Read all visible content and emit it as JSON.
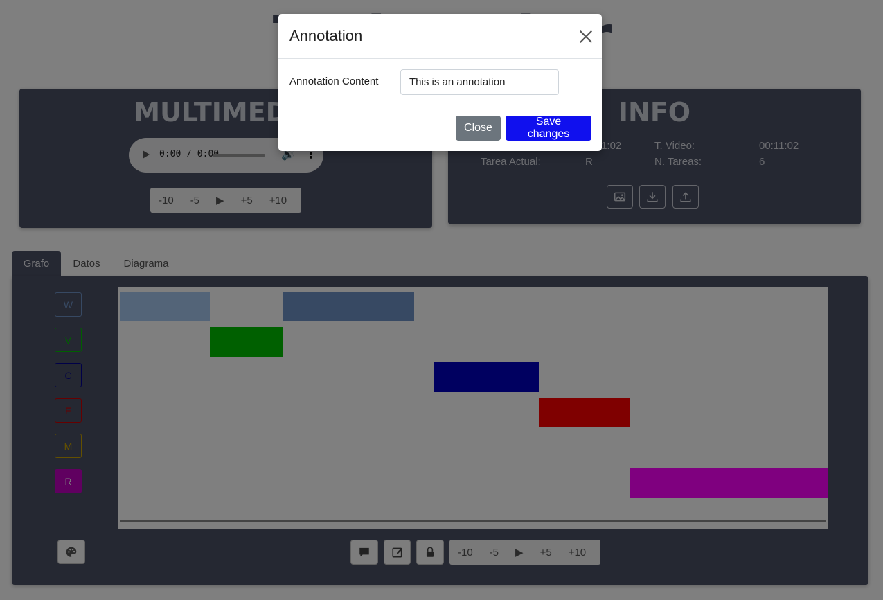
{
  "app": {
    "title": "Taskmarker"
  },
  "multimedia": {
    "title": "MULTIMEDIA",
    "audio_time": "0:00 / 0:00",
    "seek": [
      "-10",
      "-5",
      "▶",
      "+5",
      "+10"
    ]
  },
  "info": {
    "title": "INFO",
    "t_actual_value": "00:11:02",
    "t_video_label": "T. Video:",
    "t_video_value": "00:11:02",
    "tarea_label": "Tarea Actual:",
    "tarea_value": "R",
    "n_tareas_label": "N. Tareas:",
    "n_tareas_value": "6"
  },
  "tabs": [
    "Grafo",
    "Datos",
    "Diagrama"
  ],
  "legend": [
    {
      "label": "W",
      "color": "#6f93c6",
      "filled": false
    },
    {
      "label": "V",
      "color": "#00c000",
      "filled": false
    },
    {
      "label": "C",
      "color": "#000090",
      "filled": false
    },
    {
      "label": "E",
      "color": "#cc0000",
      "filled": false
    },
    {
      "label": "M",
      "color": "#c8a000",
      "filled": false
    },
    {
      "label": "R",
      "color": "#c000c0",
      "filled": true
    }
  ],
  "graph_seek": [
    "-10",
    "-5",
    "▶",
    "+5",
    "+10"
  ],
  "chart_data": {
    "type": "timeline",
    "rows": [
      "W",
      "V",
      "C",
      "E",
      "M",
      "R"
    ],
    "segments": [
      {
        "row": "W",
        "start": 0.0,
        "end": 0.127,
        "color": "#a6c8f0"
      },
      {
        "row": "W",
        "start": 0.23,
        "end": 0.416,
        "color": "#6f93c6"
      },
      {
        "row": "V",
        "start": 0.127,
        "end": 0.23,
        "color": "#00c000"
      },
      {
        "row": "C",
        "start": 0.443,
        "end": 0.592,
        "color": "#0000c0"
      },
      {
        "row": "E",
        "start": 0.592,
        "end": 0.721,
        "color": "#ff0000"
      },
      {
        "row": "R",
        "start": 0.721,
        "end": 1.0,
        "color": "#ff00ff"
      }
    ]
  },
  "modal": {
    "title": "Annotation",
    "field_label": "Annotation Content",
    "field_value": "This is an annotation",
    "close_label": "Close",
    "save_label": "Save changes"
  }
}
